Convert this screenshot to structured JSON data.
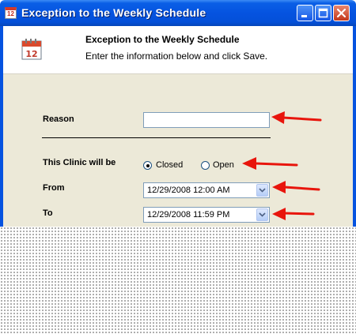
{
  "window": {
    "title": "Exception to the Weekly Schedule",
    "icon_text": "12"
  },
  "header": {
    "title": "Exception to the Weekly Schedule",
    "subtitle": "Enter the information below and click Save.",
    "calendar_day": "12"
  },
  "form": {
    "reason_label": "Reason",
    "reason_value": "",
    "clinic_label": "This Clinic will be",
    "options": [
      {
        "label": "Closed",
        "selected": true
      },
      {
        "label": "Open",
        "selected": false
      }
    ],
    "from_label": "From",
    "from_value": "12/29/2008 12:00 AM",
    "to_label": "To",
    "to_value": "12/29/2008 11:59 PM"
  },
  "colors": {
    "titlebar": "#0553e0",
    "panel": "#ece9d8",
    "annotation_arrow": "#e8150c"
  }
}
